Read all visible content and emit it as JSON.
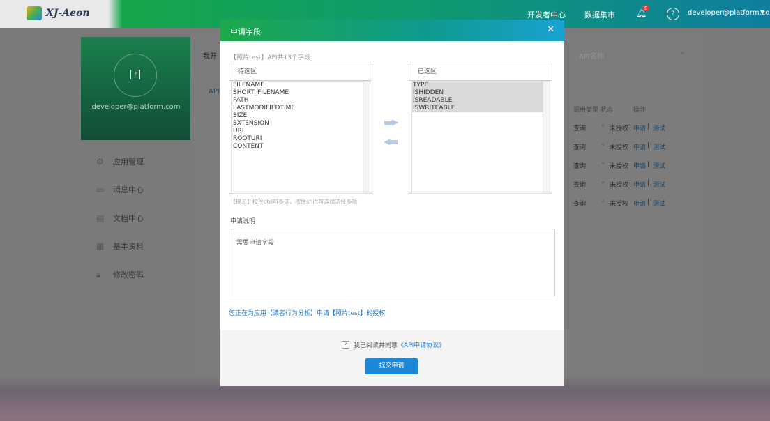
{
  "app": {
    "logo_text": "XJ-Aeon"
  },
  "topbar": {
    "links": [
      "开发者中心",
      "数据集市"
    ],
    "notification_count": "0",
    "user_email": "developer@platform.com"
  },
  "sidebar": {
    "user_email": "developer@platform.com",
    "items": [
      {
        "label": "应用管理",
        "icon": "gear-icon"
      },
      {
        "label": "消息中心",
        "icon": "message-icon"
      },
      {
        "label": "文档中心",
        "icon": "document-icon"
      },
      {
        "label": "基本资料",
        "icon": "profile-icon"
      },
      {
        "label": "修改密码",
        "icon": "lock-icon"
      }
    ]
  },
  "background": {
    "frag_top": "我开",
    "frag_api": "API",
    "search_placeholder": "API名称",
    "columns": [
      "调用类型",
      "状态",
      "操作"
    ],
    "rows": [
      {
        "type": "查询",
        "status": "未授权",
        "apply": "申请",
        "test": "测试"
      },
      {
        "type": "查询",
        "status": "未授权",
        "apply": "申请",
        "test": "测试"
      },
      {
        "type": "查询",
        "status": "未授权",
        "apply": "申请",
        "test": "测试"
      },
      {
        "type": "查询",
        "status": "未授权",
        "apply": "申请",
        "test": "测试"
      },
      {
        "type": "查询",
        "status": "未授权",
        "apply": "申请",
        "test": "测试"
      }
    ]
  },
  "modal": {
    "title": "申请字段",
    "close_icon": "close-icon",
    "field_count": "【照片test】API共13个字段",
    "candidate_title": "待选区",
    "candidate_fields": [
      "FILENAME",
      "SHORT_FILENAME",
      "PATH",
      "LASTMODIFIEDTIME",
      "SIZE",
      "EXTENSION",
      "URI",
      "ROOTURI",
      "CONTENT"
    ],
    "selected_title": "已选区",
    "selected_fields": [
      "TYPE",
      "ISHIDDEN",
      "ISREADABLE",
      "ISWRITEABLE"
    ],
    "hint": "【提示】按住ctrl可多选，按住shift可连续选择多项",
    "desc_label": "申请说明",
    "desc_value": "需要申请字段",
    "apply_note": "您正在为应用【读者行为分析】申请【照片test】的授权",
    "agree_text": "我已阅读并同意",
    "agree_link": "《API申请协议》",
    "submit_label": "提交申请"
  },
  "colors": {
    "accent_green": "#1ea84a",
    "accent_blue": "#1e88d8",
    "link_blue": "#1e7bd3"
  }
}
